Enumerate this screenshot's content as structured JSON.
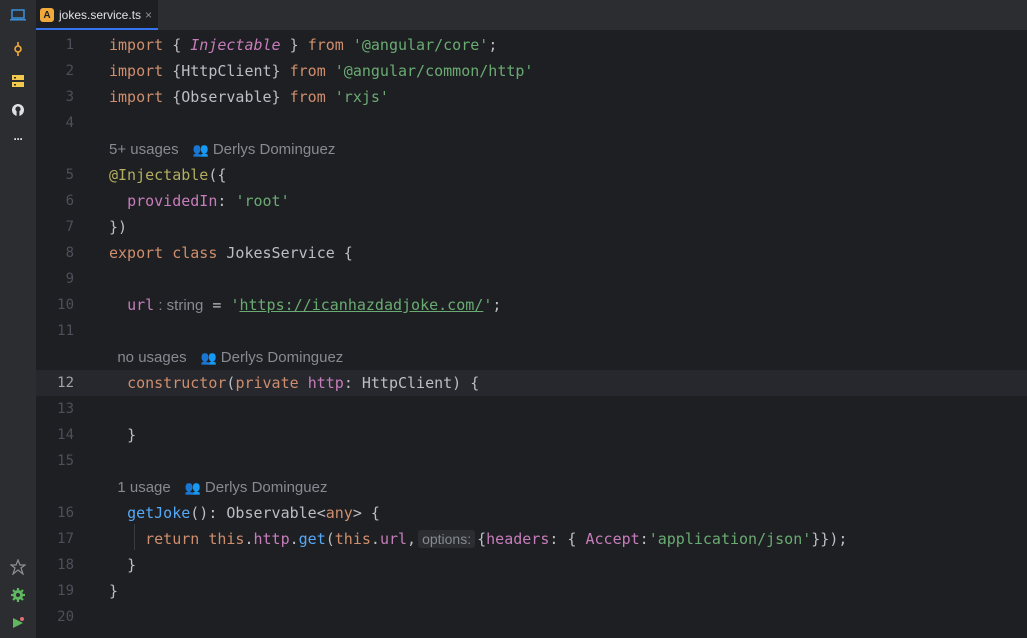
{
  "tab": {
    "icon_letter": "A",
    "label": "jokes.service.ts",
    "close": "×"
  },
  "left_strip": {
    "top_icons": [
      "commit-icon",
      "structure-icon",
      "github-icon",
      "more-icon"
    ],
    "bottom_icons": [
      "problems-icon",
      "settings-icon",
      "run-icon"
    ],
    "more_glyph": "···"
  },
  "hints": {
    "h1": {
      "usages": "5+ usages",
      "author": "Derlys Dominguez"
    },
    "h2": {
      "usages": "no usages",
      "author": "Derlys Dominguez"
    },
    "h3": {
      "usages": "1 usage",
      "author": "Derlys Dominguez"
    }
  },
  "lines": {
    "l1": {
      "n": "1",
      "a": "import",
      "b": " { ",
      "c": "Injectable",
      "d": " } ",
      "e": "from",
      "f": " '@angular/core'",
      "g": ";"
    },
    "l2": {
      "n": "2",
      "a": "import",
      "b": " {HttpClient} ",
      "e": "from",
      "f": " '@angular/common/http'"
    },
    "l3": {
      "n": "3",
      "a": "import",
      "b": " {Observable} ",
      "e": "from",
      "f": " 'rxjs'"
    },
    "l4": {
      "n": "4"
    },
    "l5": {
      "n": "5",
      "a": "@Injectable",
      "b": "({"
    },
    "l6": {
      "n": "6",
      "a": "providedIn",
      "b": ": ",
      "c": "'root'"
    },
    "l7": {
      "n": "7",
      "a": "})"
    },
    "l8": {
      "n": "8",
      "a": "export",
      "b": " ",
      "c": "class",
      "d": " JokesService {"
    },
    "l9": {
      "n": "9"
    },
    "l10": {
      "n": "10",
      "a": "url",
      "type": " : string",
      "b": " = ",
      "q1": "'",
      "url": "https://icanhazdadjoke.com/",
      "q2": "'",
      "c": ";"
    },
    "l11": {
      "n": "11"
    },
    "l12": {
      "n": "12",
      "a": "constructor",
      "b": "(",
      "c": "private",
      "d": " ",
      "e": "http",
      "f": ": HttpClient) {"
    },
    "l13": {
      "n": "13"
    },
    "l14": {
      "n": "14",
      "a": "}"
    },
    "l15": {
      "n": "15"
    },
    "l16": {
      "n": "16",
      "a": "getJoke",
      "b": "(): Observable<",
      "c": "any",
      "d": "> {"
    },
    "l17": {
      "n": "17",
      "a": "return",
      "b": " ",
      "c": "this",
      "d": ".",
      "e": "http",
      "f": ".",
      "g": "get",
      "h": "(",
      "i": "this",
      "j": ".",
      "k": "url",
      "l": ",",
      "hint": "options:",
      "m": "{",
      "n2": "headers",
      "o": ": { ",
      "p": "Accept",
      "q": ":",
      "r": "'application/json'",
      "s": "}});"
    },
    "l18": {
      "n": "18",
      "a": "}"
    },
    "l19": {
      "n": "19",
      "a": "}"
    },
    "l20": {
      "n": "20"
    }
  }
}
